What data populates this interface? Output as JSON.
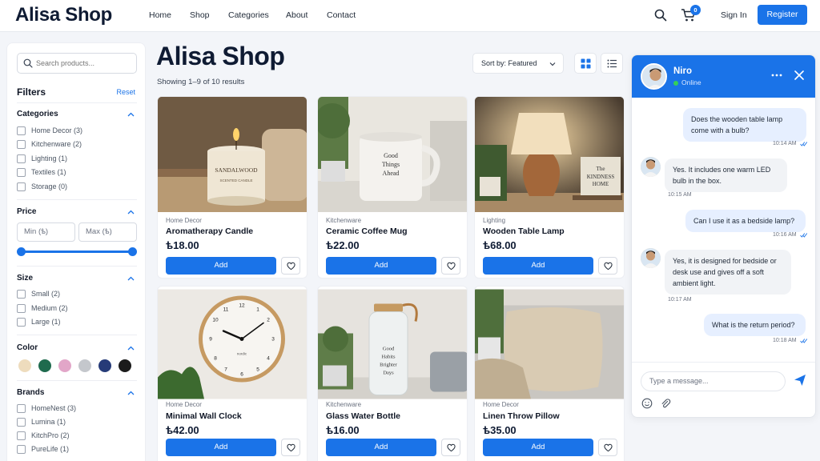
{
  "header": {
    "brand": "Alisa Shop",
    "nav": [
      "Home",
      "Shop",
      "Categories",
      "About",
      "Contact"
    ],
    "cart_count": "0",
    "signin": "Sign In",
    "register": "Register"
  },
  "sidebar": {
    "search_placeholder": "Search products...",
    "filters_title": "Filters",
    "reset": "Reset",
    "categories": {
      "title": "Categories",
      "items": [
        "Home Decor (3)",
        "Kitchenware (2)",
        "Lighting (1)",
        "Textiles (1)",
        "Storage (0)"
      ]
    },
    "price": {
      "title": "Price",
      "min_placeholder": "Min (ѣ)",
      "max_placeholder": "Max (ѣ)"
    },
    "size": {
      "title": "Size",
      "items": [
        "Small (2)",
        "Medium (2)",
        "Large (1)"
      ]
    },
    "color": {
      "title": "Color",
      "swatches": [
        "#eedcbd",
        "#1f6b4e",
        "#e2a6c8",
        "#c4c7cc",
        "#263b78",
        "#1b1b1b"
      ]
    },
    "brands": {
      "title": "Brands",
      "items": [
        "HomeNest (3)",
        "Lumina (1)",
        "KitchPro (2)",
        "PureLife (1)"
      ]
    }
  },
  "main": {
    "title": "Alisa Shop",
    "results": "Showing 1–9 of 10 results",
    "sort": "Sort by: Featured",
    "products": [
      {
        "category": "Home Decor",
        "name": "Aromatherapy Candle",
        "price": "ѣ18.00",
        "add": "Add",
        "img_label": "SANDALWOOD",
        "img_sub": "SCENTED CANDLE"
      },
      {
        "category": "Kitchenware",
        "name": "Ceramic Coffee Mug",
        "price": "ѣ22.00",
        "add": "Add",
        "img_label": "Good Things Ahead"
      },
      {
        "category": "Lighting",
        "name": "Wooden Table Lamp",
        "price": "ѣ68.00",
        "add": "Add",
        "img_label": "The KINDNESS HOME"
      },
      {
        "category": "Home Decor",
        "name": "Minimal Wall Clock",
        "price": "ѣ42.00",
        "add": "Add",
        "img_label": "nordic"
      },
      {
        "category": "Kitchenware",
        "name": "Glass Water Bottle",
        "price": "ѣ16.00",
        "add": "Add",
        "img_label": "Good Habits Brighter Days"
      },
      {
        "category": "Home Decor",
        "name": "Linen Throw Pillow",
        "price": "ѣ35.00",
        "add": "Add"
      }
    ]
  },
  "chat": {
    "name": "Niro",
    "status": "Online",
    "input_placeholder": "Type a message...",
    "messages": [
      {
        "dir": "out",
        "text": "Does the wooden table lamp come with a bulb?",
        "time": "10:14 AM"
      },
      {
        "dir": "in",
        "text": "Yes. It includes one warm LED bulb in the box.",
        "time": "10:15 AM"
      },
      {
        "dir": "out",
        "text": "Can I use it as a bedside lamp?",
        "time": "10:16 AM"
      },
      {
        "dir": "in",
        "text": "Yes, it is designed for bedside or desk use and gives off a soft ambient light.",
        "time": "10:17 AM"
      },
      {
        "dir": "out",
        "text": "What is the return period?",
        "time": "10:18 AM"
      }
    ]
  }
}
